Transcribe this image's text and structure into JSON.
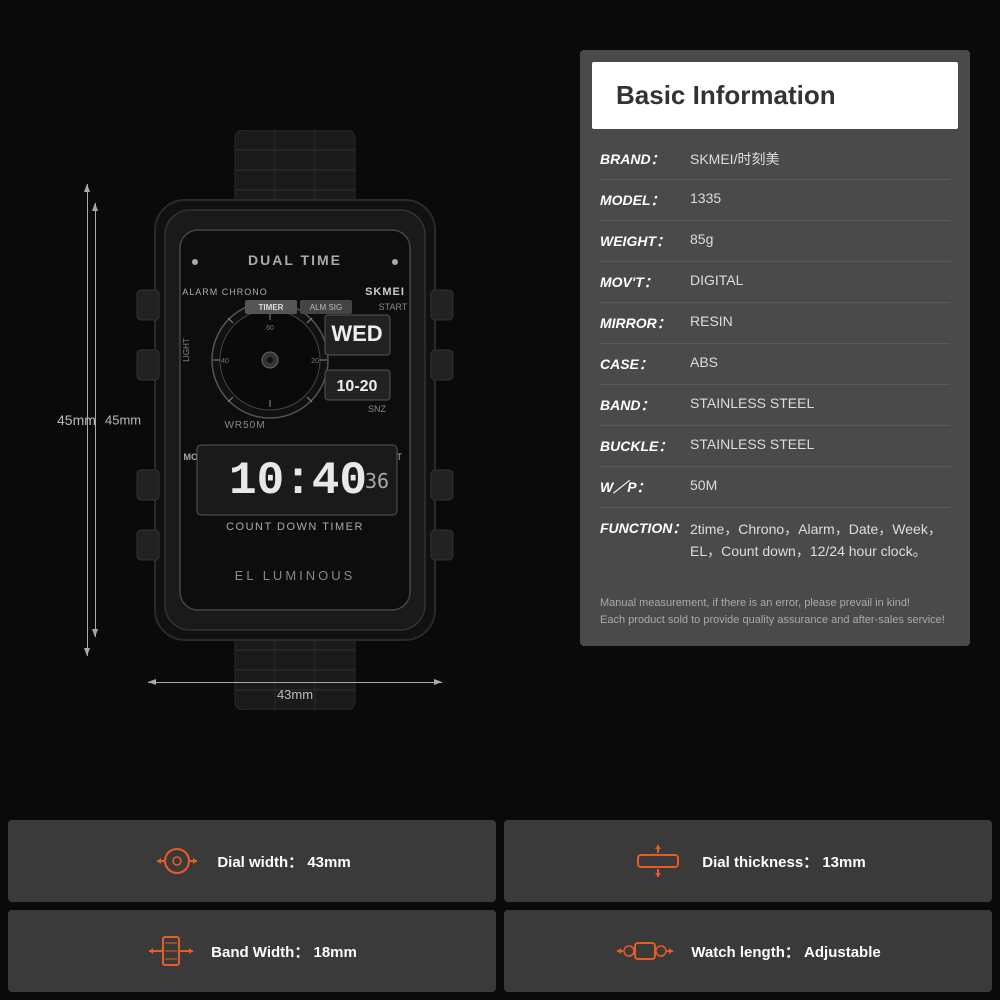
{
  "header": {
    "title": "Basic Information"
  },
  "watch": {
    "dimension_height": "45mm",
    "dimension_width": "43mm"
  },
  "specs": [
    {
      "label": "BRAND：",
      "value": "SKMEI/时刻美"
    },
    {
      "label": "MODEL：",
      "value": "1335"
    },
    {
      "label": "WEIGHT：",
      "value": "85g"
    },
    {
      "label": "MOV'T：",
      "value": "DIGITAL"
    },
    {
      "label": "MIRROR：",
      "value": "RESIN"
    },
    {
      "label": "CASE：",
      "value": "ABS"
    },
    {
      "label": "BAND：",
      "value": "STAINLESS STEEL"
    },
    {
      "label": "BUCKLE：",
      "value": "STAINLESS STEEL"
    },
    {
      "label": "W／P：",
      "value": "50M"
    },
    {
      "label": "FUNCTION：",
      "value": "2time，Chrono，Alarm，Date，Week，EL，Count down，12/24 hour clock。"
    }
  ],
  "note": {
    "line1": "Manual measurement, if there is an error, please prevail in kind!",
    "line2": "Each product sold to provide quality assurance and after-sales service!"
  },
  "bottom_specs": [
    {
      "icon": "dial-width-icon",
      "label": "Dial width：",
      "value": "43mm"
    },
    {
      "icon": "dial-thickness-icon",
      "label": "Dial thickness：",
      "value": "13mm"
    },
    {
      "icon": "band-width-icon",
      "label": "Band Width：",
      "value": "18mm"
    },
    {
      "icon": "watch-length-icon",
      "label": "Watch length：",
      "value": "Adjustable"
    }
  ]
}
